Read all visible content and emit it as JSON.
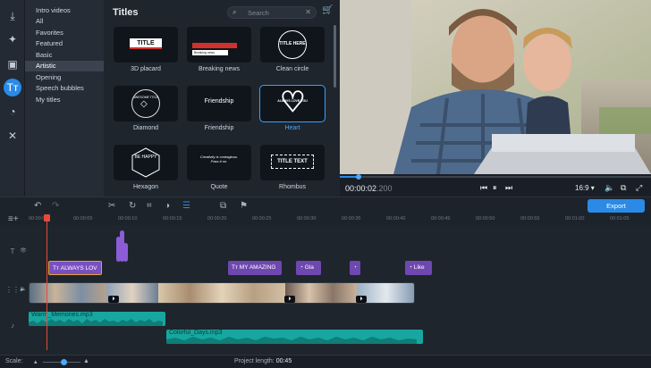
{
  "categories": [
    "Intro videos",
    "All",
    "Favorites",
    "Featured",
    "Basic",
    "Artistic",
    "Opening",
    "Speech bubbles",
    "My titles"
  ],
  "selected_category": "Artistic",
  "panel_title": "Titles",
  "search": {
    "placeholder": "Search"
  },
  "tiles": [
    {
      "label": "3D placard",
      "art": "TITLE"
    },
    {
      "label": "Breaking news",
      "art": "Breaking news"
    },
    {
      "label": "Clean circle",
      "art": "TITLE HERE"
    },
    {
      "label": "Diamond",
      "art": "AWESOME TITLE"
    },
    {
      "label": "Friendship",
      "art": "Friendship"
    },
    {
      "label": "Heart",
      "art": "ALWAYS LOVE YOU"
    },
    {
      "label": "Hexagon",
      "art": "BE HAPPY"
    },
    {
      "label": "Quote",
      "art": "Creativity is contagious. Pass it on."
    },
    {
      "label": "Rhombus",
      "art": "TITLE TEXT"
    }
  ],
  "selected_tile": "Heart",
  "player": {
    "time_main": "00:00:02",
    "time_ms": ".200",
    "aspect": "16:9",
    "progress": 0.06
  },
  "export_label": "Export",
  "ruler": [
    "00:00:00",
    "00:00:05",
    "00:00:10",
    "00:00:15",
    "00:00:20",
    "00:00:25",
    "00:00:30",
    "00:00:35",
    "00:00:40",
    "00:00:45",
    "00:00:50",
    "00:00:55",
    "00:01:00",
    "00:01:05"
  ],
  "title_clips": [
    {
      "text": "ALWAYS LOV",
      "selected": true
    },
    {
      "text": "MY AMAZING",
      "selected": false
    },
    {
      "text": "Gla",
      "selected": false
    },
    {
      "text": "",
      "selected": false
    },
    {
      "text": "Like",
      "selected": false
    }
  ],
  "audio": [
    {
      "name": "Warm_Memories.mp3"
    },
    {
      "name": "Colorful_Days.mp3"
    }
  ],
  "footer": {
    "scale_label": "Scale:",
    "project_length_label": "Project length:",
    "project_length": "00:45"
  },
  "colors": {
    "accent": "#2a8ae6",
    "title_clip": "#6e48b0",
    "audio": "#17a7a0",
    "playhead": "#e64a3a"
  }
}
